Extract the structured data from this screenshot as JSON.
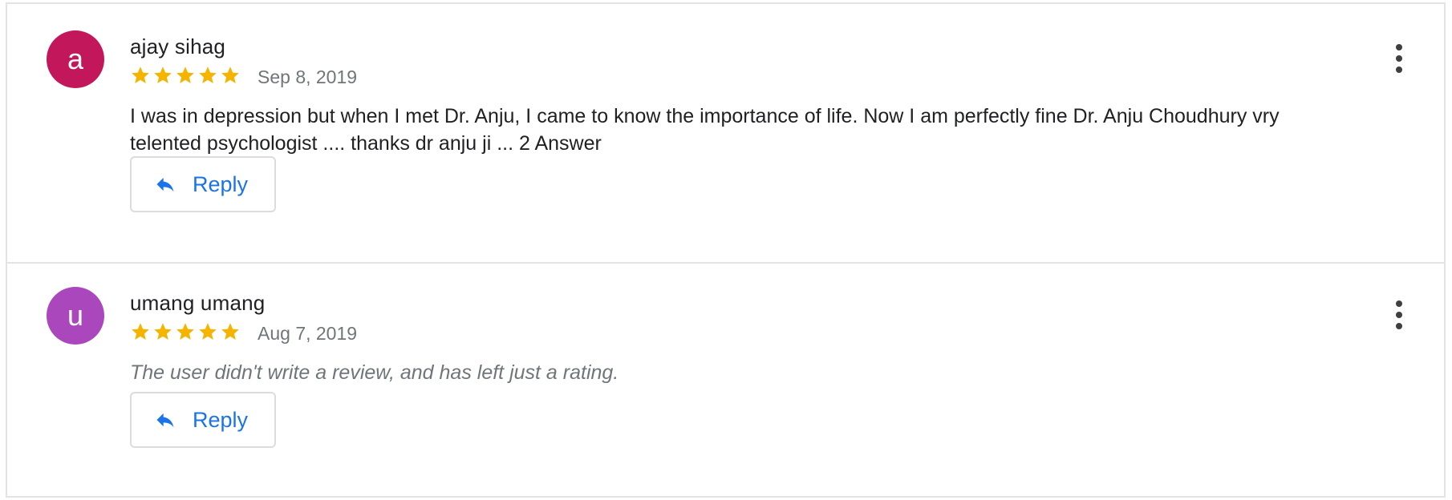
{
  "reviews": [
    {
      "avatar_letter": "a",
      "avatar_color": "#c2185b",
      "author": "ajay sihag",
      "rating": 5,
      "date": "Sep 8, 2019",
      "text": "I was in depression but when I met Dr. Anju, I came to know the importance of life. Now I am perfectly fine Dr. Anju Choudhury vry telented psychologist .... thanks dr anju ji ... 2 Answer",
      "reply_label": "Reply",
      "reply_icon": "reply-arrow-icon",
      "menu_icon": "more-vert-icon"
    },
    {
      "avatar_letter": "u",
      "avatar_color": "#ab47bc",
      "author": "umang umang",
      "rating": 5,
      "date": "Aug 7, 2019",
      "text": "The user didn't write a review, and has left just a rating.",
      "reply_label": "Reply",
      "reply_icon": "reply-arrow-icon",
      "menu_icon": "more-vert-icon"
    }
  ],
  "colors": {
    "star": "#f4b400",
    "link": "#1a73e8",
    "muted": "#70757a",
    "divider": "#e3e3e3"
  }
}
